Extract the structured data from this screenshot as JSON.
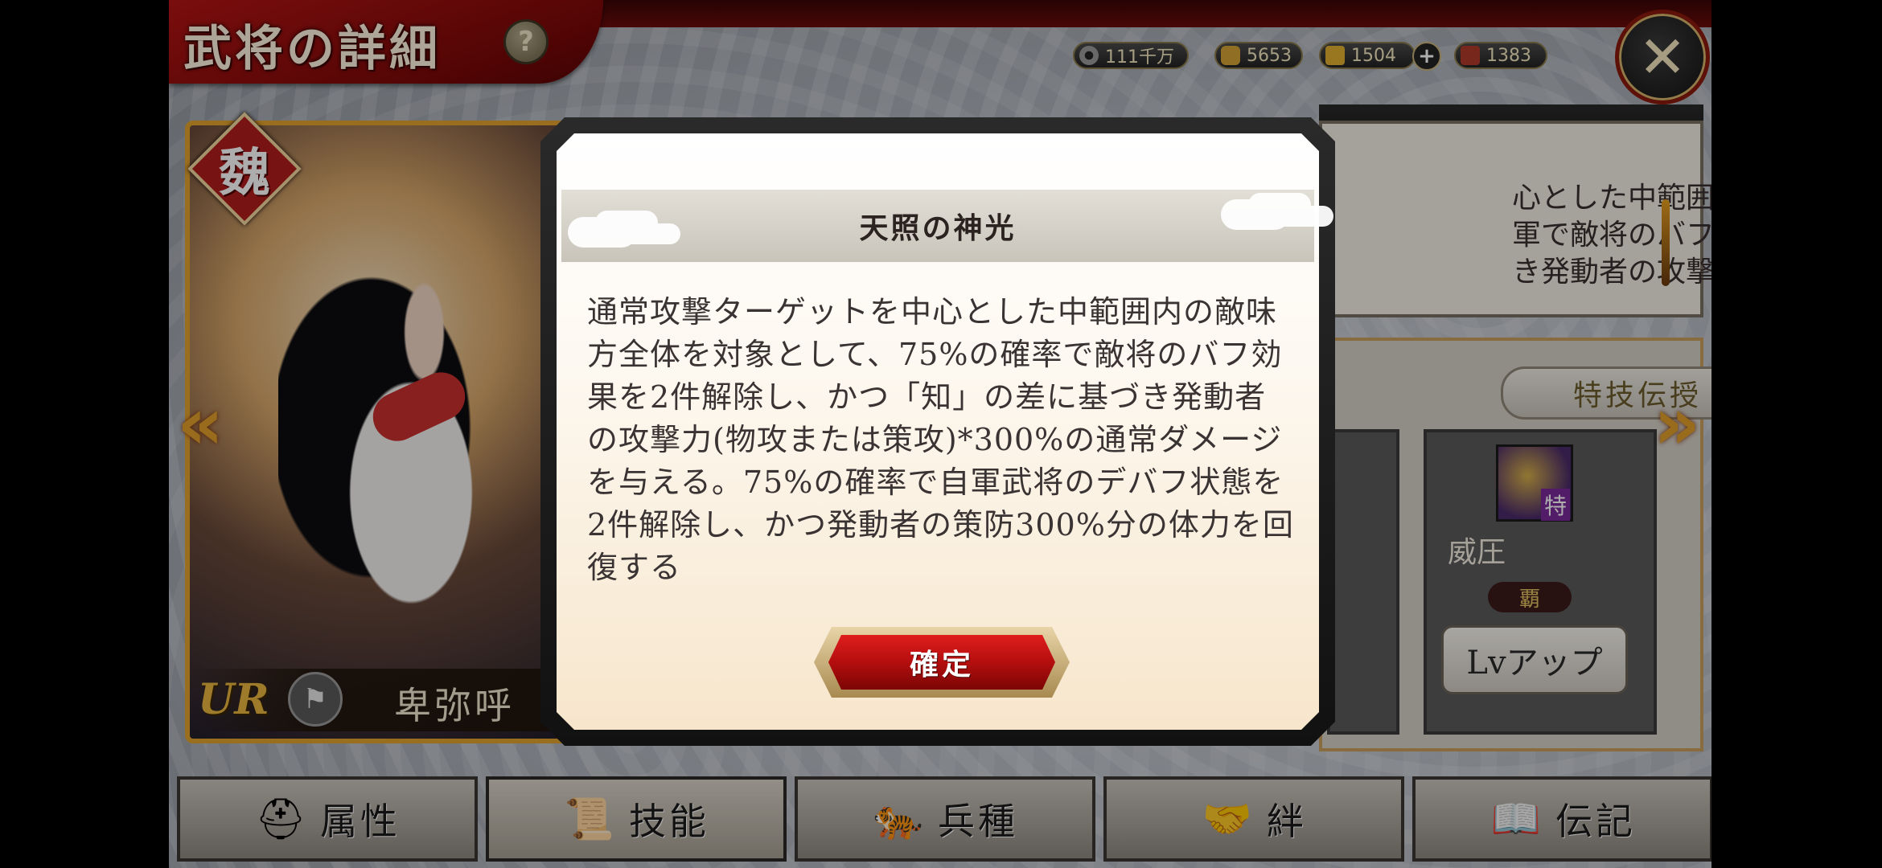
{
  "header": {
    "title": "武将の詳細",
    "help_glyph": "?",
    "close_glyph": "✕"
  },
  "currencies": [
    {
      "name": "coin",
      "value": "111千万",
      "color": "#9a9a9a"
    },
    {
      "name": "gold",
      "value": "5653",
      "color": "#d4a437"
    },
    {
      "name": "ingot",
      "value": "1504",
      "color": "#e0b030"
    },
    {
      "name": "ticket",
      "value": "1383",
      "color": "#b03a2a"
    }
  ],
  "character": {
    "kingdom": "魏",
    "rarity": "UR",
    "name": "卑弥呼"
  },
  "background_panel": {
    "desc_text": "心とした中範囲内の\n軍で敵将のバフ効果\nき発動者の攻撃力(",
    "teach_button": "特技伝授",
    "skill_name": "威圧",
    "skill_rank": "覇",
    "skill_icon_tag": "特",
    "lvup_button": "Lvアップ"
  },
  "tabs": [
    {
      "label": "属性",
      "icon": "helmet-icon"
    },
    {
      "label": "技能",
      "icon": "scroll-icon"
    },
    {
      "label": "兵種",
      "icon": "tiger-icon"
    },
    {
      "label": "絆",
      "icon": "handshake-icon"
    },
    {
      "label": "伝記",
      "icon": "book-icon"
    }
  ],
  "active_tab": "技能",
  "modal": {
    "title": "天照の神光",
    "body": "通常攻撃ターゲットを中心とした中範囲内の敵味方全体を対象として、75%の確率で敵将のバフ効果を2件解除し、かつ「知」の差に基づき発動者の攻撃力(物攻または策攻)*300%の通常ダメージを与える。75%の確率で自軍武将のデバフ状態を2件解除し、かつ発動者の策防300%分の体力を回復する",
    "confirm_button": "確定"
  }
}
